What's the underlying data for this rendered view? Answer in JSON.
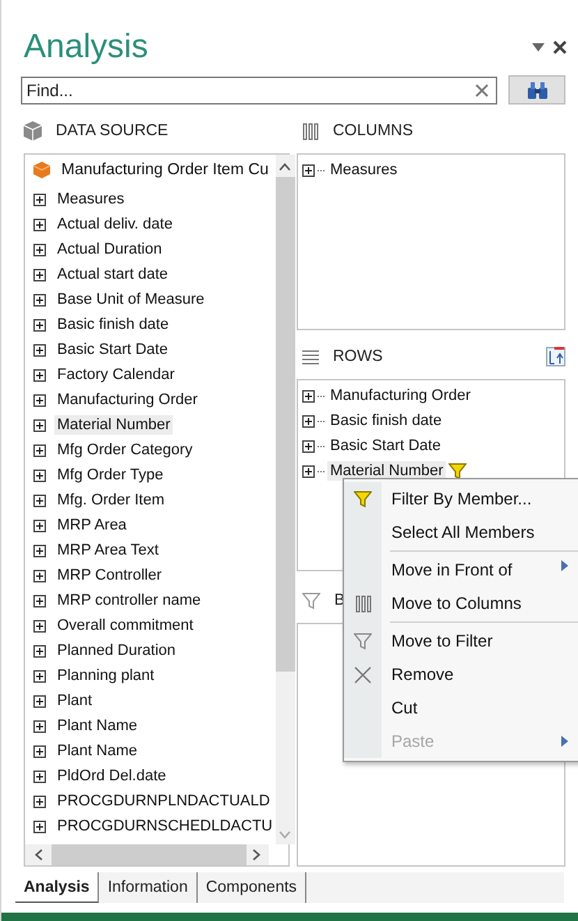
{
  "panel": {
    "title": "Analysis"
  },
  "search": {
    "placeholder": "Find..."
  },
  "data_source": {
    "title": "DATA SOURCE",
    "root": "Manufacturing Order Item Cu",
    "items": [
      {
        "label": "Measures",
        "hovered": false
      },
      {
        "label": "Actual deliv. date",
        "hovered": false
      },
      {
        "label": "Actual Duration",
        "hovered": false
      },
      {
        "label": "Actual start date",
        "hovered": false
      },
      {
        "label": "Base Unit of Measure",
        "hovered": false
      },
      {
        "label": "Basic finish date",
        "hovered": false
      },
      {
        "label": "Basic Start Date",
        "hovered": false
      },
      {
        "label": "Factory Calendar",
        "hovered": false
      },
      {
        "label": "Manufacturing Order",
        "hovered": false
      },
      {
        "label": "Material Number",
        "hovered": true
      },
      {
        "label": "Mfg Order Category",
        "hovered": false
      },
      {
        "label": "Mfg Order Type",
        "hovered": false
      },
      {
        "label": "Mfg. Order Item",
        "hovered": false
      },
      {
        "label": "MRP Area",
        "hovered": false
      },
      {
        "label": "MRP Area Text",
        "hovered": false
      },
      {
        "label": "MRP Controller",
        "hovered": false
      },
      {
        "label": "MRP controller name",
        "hovered": false
      },
      {
        "label": "Overall commitment",
        "hovered": false
      },
      {
        "label": "Planned Duration",
        "hovered": false
      },
      {
        "label": "Planning plant",
        "hovered": false
      },
      {
        "label": "Plant",
        "hovered": false
      },
      {
        "label": "Plant Name",
        "hovered": false
      },
      {
        "label": "Plant Name",
        "hovered": false
      },
      {
        "label": "PldOrd Del.date",
        "hovered": false
      },
      {
        "label": "PROCGDURNPLNDACTUALD",
        "hovered": false
      },
      {
        "label": "PROCGDURNSCHEDLDACTU",
        "hovered": false
      }
    ]
  },
  "columns": {
    "title": "COLUMNS",
    "items": [
      {
        "label": "Measures"
      }
    ]
  },
  "rows": {
    "title": "ROWS",
    "items": [
      {
        "label": "Manufacturing Order",
        "filtered": false,
        "hovered": false
      },
      {
        "label": "Basic finish date",
        "filtered": false,
        "hovered": false
      },
      {
        "label": "Basic Start Date",
        "filtered": false,
        "hovered": false
      },
      {
        "label": "Material Number",
        "filtered": true,
        "hovered": true
      }
    ]
  },
  "filter": {
    "title": "B"
  },
  "context_menu": {
    "items": [
      {
        "label": "Filter By Member...",
        "kind": "filter",
        "separator_before": false,
        "submenu": false,
        "disabled": false
      },
      {
        "label": "Select All Members",
        "kind": "plain",
        "separator_before": false,
        "submenu": false,
        "disabled": false
      },
      {
        "label": "Move in Front of",
        "kind": "plain",
        "separator_before": true,
        "submenu": true,
        "disabled": false
      },
      {
        "label": "Move to Columns",
        "kind": "columns",
        "separator_before": false,
        "submenu": false,
        "disabled": false
      },
      {
        "label": "Move to Filter",
        "kind": "funnel",
        "separator_before": true,
        "submenu": false,
        "disabled": false
      },
      {
        "label": "Remove",
        "kind": "remove",
        "separator_before": false,
        "submenu": false,
        "disabled": false
      },
      {
        "label": "Cut",
        "kind": "plain",
        "separator_before": false,
        "submenu": false,
        "disabled": false
      },
      {
        "label": "Paste",
        "kind": "plain",
        "separator_before": false,
        "submenu": true,
        "disabled": true
      }
    ]
  },
  "tabs": [
    {
      "label": "Analysis",
      "selected": true
    },
    {
      "label": "Information",
      "selected": false
    },
    {
      "label": "Components",
      "selected": false
    }
  ]
}
